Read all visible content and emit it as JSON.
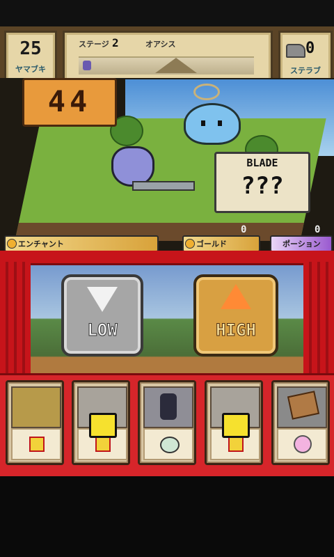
{
  "top_left_box": {
    "value": "25",
    "label": "ヤマブキ"
  },
  "stage_bar": {
    "stage_label": "ステージ",
    "stage_number": "2",
    "location": "オアシス"
  },
  "top_right_box": {
    "value": "0",
    "label": "ステラブ"
  },
  "countdown": {
    "value": "44"
  },
  "blade_sign": {
    "title": "BLADE",
    "value": "???"
  },
  "resource_bars": [
    {
      "label": "エンチャント",
      "value": ""
    },
    {
      "label": "ゴールド",
      "value": "0"
    },
    {
      "label": "ポーション",
      "value": "0"
    }
  ],
  "buttons": {
    "low": "LOW",
    "high": "HIGH"
  },
  "cards": [
    {
      "name": "hero-card-yellow",
      "locked": false,
      "item": "scroll-icon"
    },
    {
      "name": "hero-card-2",
      "locked": true,
      "item": "scroll-icon"
    },
    {
      "name": "hero-card-dark",
      "locked": false,
      "item": "egg-icon"
    },
    {
      "name": "hero-card-4",
      "locked": true,
      "item": "scroll-icon"
    },
    {
      "name": "hero-card-map",
      "locked": false,
      "item": "pink-face-icon"
    }
  ],
  "colors": {
    "curtain": "#c7141a",
    "gold": "#d8a23a",
    "accent_orange": "#ff8a35"
  }
}
